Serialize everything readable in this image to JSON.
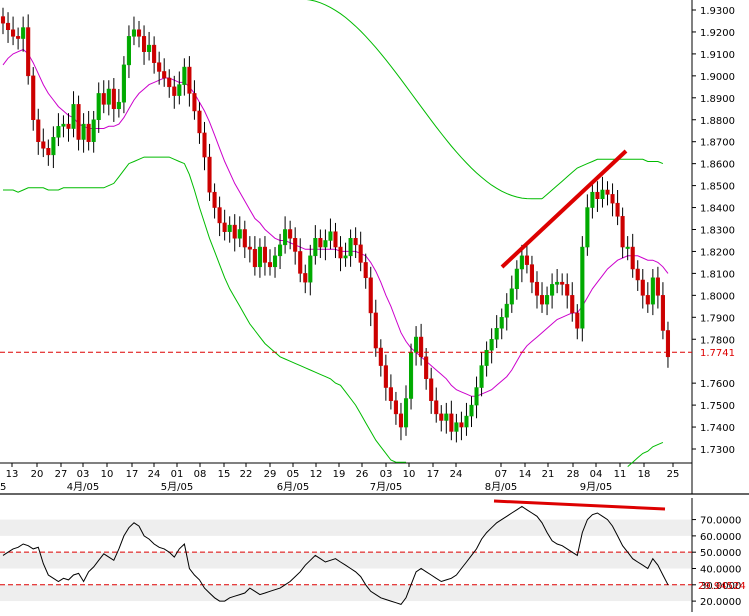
{
  "chart_data": [
    {
      "type": "candlestick",
      "title": "",
      "ylim": [
        1.7245,
        1.935
      ],
      "y_ticks": [
        "1.9300",
        "1.9200",
        "1.9100",
        "1.9000",
        "1.8900",
        "1.8800",
        "1.8700",
        "1.8600",
        "1.8500",
        "1.8400",
        "1.8300",
        "1.8200",
        "1.8100",
        "1.8000",
        "1.7900",
        "1.7800",
        "1.7600",
        "1.7500",
        "1.7400",
        "1.7300"
      ],
      "x_ticks": [
        "13",
        "20",
        "27",
        "03",
        "10",
        "17",
        "24",
        "01",
        "08",
        "15",
        "22",
        "29",
        "05",
        "12",
        "19",
        "26",
        "03",
        "10",
        "17",
        "24",
        "07",
        "14",
        "21",
        "28",
        "04",
        "11",
        "18",
        "25"
      ],
      "month_labels": [
        {
          "label": "4月/05",
          "after_day": "03"
        },
        {
          "label": "5月/05",
          "after_day": "01"
        },
        {
          "label": "6月/05",
          "after_day": "05"
        },
        {
          "label": "7月/05",
          "after_day": "03"
        },
        {
          "label": "8月/05",
          "after_day": "07"
        },
        {
          "label": "9月/05",
          "after_day": "04"
        }
      ],
      "left_edge_label": "5",
      "current_price": "1.7741",
      "current_price_value": 1.7741,
      "colors": {
        "up": "#00aa00",
        "down": "#cc0000",
        "ma": "#cc00cc",
        "bands": "#00bb00",
        "trendline": "#dd0000"
      },
      "series": [
        {
          "kind": "price_close",
          "values": [
            1.924,
            1.921,
            1.918,
            1.917,
            1.922,
            1.9,
            1.88,
            1.87,
            1.867,
            1.864,
            1.872,
            1.877,
            1.878,
            1.876,
            1.887,
            1.871,
            1.878,
            1.87,
            1.88,
            1.892,
            1.887,
            1.894,
            1.885,
            1.888,
            1.905,
            1.918,
            1.921,
            1.918,
            1.911,
            1.914,
            1.906,
            1.902,
            1.899,
            1.895,
            1.891,
            1.896,
            1.904,
            1.892,
            1.884,
            1.874,
            1.863,
            1.847,
            1.84,
            1.833,
            1.829,
            1.832,
            1.826,
            1.83,
            1.822,
            1.821,
            1.813,
            1.822,
            1.815,
            1.813,
            1.818,
            1.823,
            1.83,
            1.826,
            1.82,
            1.81,
            1.806,
            1.818,
            1.826,
            1.822,
            1.825,
            1.829,
            1.822,
            1.817,
            1.818,
            1.826,
            1.823,
            1.815,
            1.808,
            1.792,
            1.776,
            1.768,
            1.758,
            1.752,
            1.746,
            1.74,
            1.753,
            1.774,
            1.781,
            1.772,
            1.762,
            1.752,
            1.746,
            1.743,
            1.746,
            1.738,
            1.742,
            1.74,
            1.745,
            1.75,
            1.758,
            1.768,
            1.775,
            1.78,
            1.785,
            1.79,
            1.796,
            1.803,
            1.812,
            1.818,
            1.814,
            1.806,
            1.8,
            1.796,
            1.8,
            1.805,
            1.806,
            1.805,
            1.8,
            1.792,
            1.785,
            1.822,
            1.84,
            1.847,
            1.844,
            1.848,
            1.846,
            1.842,
            1.836,
            1.822,
            1.822,
            1.812,
            1.807,
            1.8,
            1.796,
            1.808,
            1.8,
            1.784,
            1.772
          ]
        },
        {
          "kind": "moving_average",
          "values": [
            1.905,
            1.908,
            1.91,
            1.911,
            1.912,
            1.91,
            1.906,
            1.901,
            1.896,
            1.892,
            1.889,
            1.886,
            1.884,
            1.882,
            1.881,
            1.878,
            1.877,
            1.876,
            1.876,
            1.876,
            1.876,
            1.877,
            1.877,
            1.878,
            1.881,
            1.885,
            1.889,
            1.892,
            1.894,
            1.896,
            1.897,
            1.898,
            1.899,
            1.899,
            1.898,
            1.897,
            1.897,
            1.895,
            1.892,
            1.888,
            1.884,
            1.879,
            1.873,
            1.867,
            1.861,
            1.856,
            1.851,
            1.847,
            1.843,
            1.839,
            1.835,
            1.833,
            1.83,
            1.828,
            1.826,
            1.825,
            1.825,
            1.824,
            1.823,
            1.822,
            1.821,
            1.821,
            1.821,
            1.821,
            1.821,
            1.821,
            1.821,
            1.82,
            1.82,
            1.82,
            1.82,
            1.819,
            1.818,
            1.815,
            1.811,
            1.806,
            1.8,
            1.795,
            1.789,
            1.783,
            1.779,
            1.776,
            1.774,
            1.772,
            1.77,
            1.768,
            1.766,
            1.764,
            1.762,
            1.759,
            1.757,
            1.756,
            1.755,
            1.754,
            1.754,
            1.755,
            1.756,
            1.757,
            1.759,
            1.761,
            1.763,
            1.766,
            1.77,
            1.774,
            1.777,
            1.779,
            1.781,
            1.783,
            1.785,
            1.787,
            1.789,
            1.79,
            1.791,
            1.792,
            1.792,
            1.795,
            1.799,
            1.803,
            1.806,
            1.809,
            1.812,
            1.814,
            1.816,
            1.817,
            1.818,
            1.818,
            1.818,
            1.817,
            1.816,
            1.816,
            1.815,
            1.813,
            1.81
          ]
        },
        {
          "kind": "upper_band_segment",
          "x_index_range": [
            107,
            131
          ],
          "values": [
            1.844,
            1.846,
            1.848,
            1.85,
            1.852,
            1.854,
            1.856,
            1.858,
            1.859,
            1.86,
            1.861,
            1.862,
            1.862,
            1.862,
            1.862,
            1.862,
            1.862,
            1.862,
            1.862,
            1.862,
            1.862,
            1.861,
            1.861,
            1.861,
            1.86
          ]
        },
        {
          "kind": "lower_band_segment",
          "x_index_range": [
            0,
            80
          ],
          "values": [
            1.848,
            1.848,
            1.848,
            1.847,
            1.848,
            1.849,
            1.849,
            1.849,
            1.849,
            1.848,
            1.848,
            1.848,
            1.849,
            1.849,
            1.849,
            1.849,
            1.849,
            1.849,
            1.849,
            1.849,
            1.849,
            1.85,
            1.851,
            1.854,
            1.857,
            1.86,
            1.861,
            1.862,
            1.863,
            1.863,
            1.863,
            1.863,
            1.863,
            1.863,
            1.862,
            1.861,
            1.86,
            1.855,
            1.848,
            1.84,
            1.833,
            1.826,
            1.82,
            1.814,
            1.808,
            1.803,
            1.799,
            1.795,
            1.791,
            1.787,
            1.784,
            1.781,
            1.778,
            1.776,
            1.774,
            1.772,
            1.771,
            1.77,
            1.769,
            1.768,
            1.767,
            1.766,
            1.765,
            1.764,
            1.763,
            1.762,
            1.76,
            1.759,
            1.756,
            1.753,
            1.75,
            1.746,
            1.742,
            1.738,
            1.734,
            1.731,
            1.728,
            1.725,
            1.724,
            1.724,
            1.724
          ]
        },
        {
          "kind": "upper_band_descending",
          "note_x_range": [
            59,
            107
          ],
          "start": 1.935,
          "end": 1.844
        },
        {
          "kind": "lower_band_rising_end",
          "x_index_range": [
            124,
            131
          ],
          "values": [
            1.722,
            1.724,
            1.726,
            1.728,
            1.729,
            1.731,
            1.732,
            1.733
          ]
        }
      ]
    },
    {
      "type": "line",
      "title": "",
      "ylim": [
        17,
        82
      ],
      "y_ticks": [
        "70.0000",
        "60.0000",
        "50.0000",
        "40.0000",
        "30.0000",
        "20.0000"
      ],
      "current_value": "29.94524",
      "reference_lines": [
        50,
        30
      ],
      "series": [
        {
          "kind": "oscillator",
          "values": [
            48,
            50,
            52,
            53,
            55,
            54,
            52,
            53,
            43,
            36,
            34,
            32,
            34,
            33,
            36,
            37,
            32,
            38,
            41,
            45,
            49,
            47,
            45,
            52,
            60,
            65,
            68,
            66,
            60,
            58,
            55,
            53,
            52,
            50,
            47,
            52,
            55,
            40,
            36,
            33,
            28,
            25,
            22,
            20,
            20,
            22,
            23,
            24,
            25,
            28,
            26,
            24,
            25,
            26,
            27,
            28,
            30,
            32,
            35,
            38,
            42,
            45,
            48,
            46,
            44,
            45,
            46,
            44,
            42,
            40,
            38,
            35,
            30,
            26,
            24,
            22,
            21,
            20,
            19,
            18,
            22,
            30,
            38,
            40,
            38,
            36,
            34,
            32,
            33,
            34,
            36,
            40,
            44,
            48,
            52,
            58,
            62,
            65,
            68,
            70,
            72,
            74,
            76,
            78,
            76,
            74,
            72,
            68,
            62,
            57,
            55,
            54,
            52,
            50,
            48,
            62,
            70,
            73,
            74,
            72,
            70,
            66,
            60,
            54,
            50,
            46,
            44,
            42,
            40,
            46,
            42,
            36,
            30
          ]
        },
        {
          "kind": "trendline",
          "from_index": 103,
          "to_index": 131,
          "start_value": 80,
          "end_value": 76.5
        }
      ]
    }
  ]
}
